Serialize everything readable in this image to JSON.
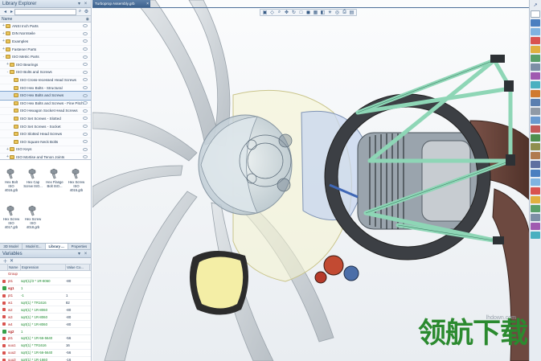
{
  "library_explorer": {
    "title": "Library Explorer",
    "search_placeholder": "",
    "column_name": "Name",
    "tree": [
      {
        "label": "ANSI Inch Parts",
        "indent": 0,
        "twist": "+"
      },
      {
        "label": "DIN Normteile",
        "indent": 0,
        "twist": "+"
      },
      {
        "label": "Examples",
        "indent": 0,
        "twist": "+"
      },
      {
        "label": "Fastener Parts",
        "indent": 0,
        "twist": "+"
      },
      {
        "label": "ISO Metric Parts",
        "indent": 0,
        "twist": "-"
      },
      {
        "label": "ISO Bearings",
        "indent": 1,
        "twist": "+"
      },
      {
        "label": "ISO Bolts and Screws",
        "indent": 1,
        "twist": "-"
      },
      {
        "label": "ISO Cross-recessed Head Screws",
        "indent": 2,
        "twist": ""
      },
      {
        "label": "ISO Hex Bolts - Structural",
        "indent": 2,
        "twist": ""
      },
      {
        "label": "ISO Hex Bolts and Screws",
        "indent": 2,
        "twist": "",
        "selected": true
      },
      {
        "label": "ISO Hex Bolts and Screws - Fine Pitch",
        "indent": 2,
        "twist": ""
      },
      {
        "label": "ISO Hexagon Socket Head Screws",
        "indent": 2,
        "twist": ""
      },
      {
        "label": "ISO Set Screws - Slotted",
        "indent": 2,
        "twist": ""
      },
      {
        "label": "ISO Set Screws - Socket",
        "indent": 2,
        "twist": ""
      },
      {
        "label": "ISO Slotted Head Screws",
        "indent": 2,
        "twist": ""
      },
      {
        "label": "ISO Square Neck Bolts",
        "indent": 2,
        "twist": ""
      },
      {
        "label": "ISO Keys",
        "indent": 1,
        "twist": "+"
      },
      {
        "label": "ISO Mortise and Tenon Joints",
        "indent": 1,
        "twist": "+"
      }
    ],
    "parts": [
      {
        "label": "Hex Bolt ISO 4016.grb"
      },
      {
        "label": "Hex Cap Screw ISO..."
      },
      {
        "label": "Hex Flange Bolt ISO..."
      },
      {
        "label": "Hex Screw ISO 4015.grb"
      },
      {
        "label": "Hex Screw ISO 4017.grb"
      },
      {
        "label": "Hex Screw ISO 4018.grb"
      }
    ]
  },
  "panel_tabs": [
    {
      "label": "3D Model"
    },
    {
      "label": "Model E..."
    },
    {
      "label": "Library ...",
      "active": true
    },
    {
      "label": "Properties"
    }
  ],
  "variables": {
    "title": "Variables",
    "columns": [
      "",
      "Name",
      "Expression",
      "Value Co..."
    ],
    "rows": [
      {
        "mark": "",
        "name": "Group",
        "expr": "",
        "val": ""
      },
      {
        "mark": "sub",
        "name": "pt1",
        "expr": "sqrt(1)/3 * 1R-8060",
        "val": "-80"
      },
      {
        "mark": "grp",
        "name": "sg1",
        "expr": "1",
        "val": ""
      },
      {
        "mark": "sub",
        "name": "pt1",
        "expr": "-1",
        "val": "1"
      },
      {
        "mark": "sub",
        "name": "w1",
        "expr": "sqrt(1) * TR1616",
        "val": "82"
      },
      {
        "mark": "sub",
        "name": "w2",
        "expr": "sqrt(1) * 1R-8060",
        "val": "-80"
      },
      {
        "mark": "sub",
        "name": "w3",
        "expr": "sqrt(1) * 1R-8060",
        "val": "-80"
      },
      {
        "mark": "sub",
        "name": "w4",
        "expr": "sqrt(1) * 1R-8060",
        "val": "-80"
      },
      {
        "mark": "grp",
        "name": "sg2",
        "expr": "1",
        "val": ""
      },
      {
        "mark": "sub",
        "name": "pt1",
        "expr": "sqrt(1) * 1R-56-5640",
        "val": "-56"
      },
      {
        "mark": "sub",
        "name": "uuu1",
        "expr": "sqrt(1) * TR1616",
        "val": "16"
      },
      {
        "mark": "sub",
        "name": "uuu2",
        "expr": "sqrt(1) * 1R-56-5640",
        "val": "-56"
      },
      {
        "mark": "sub",
        "name": "uuu3",
        "expr": "sqrt(1) * 1R-1660",
        "val": "-16"
      }
    ]
  },
  "document": {
    "tab_title": "Turboprop Assembly.grb",
    "close_glyph": "×"
  },
  "view_toolbar": {
    "icons": [
      "view-cube-icon",
      "select-icon",
      "zoom-icon",
      "pan-icon",
      "rotate-icon",
      "box-icon",
      "shade-icon",
      "wire-icon",
      "section-icon",
      "light-icon",
      "camera-icon",
      "print-icon",
      "render-icon"
    ]
  },
  "watermark": {
    "site": "lhdown.com",
    "logo": "领航下载"
  },
  "colors": {
    "accent": "#3d628d",
    "frame_green": "#8ed6b6",
    "disk_dark": "#3c3f44",
    "intake_yellow": "#f4eea6"
  }
}
